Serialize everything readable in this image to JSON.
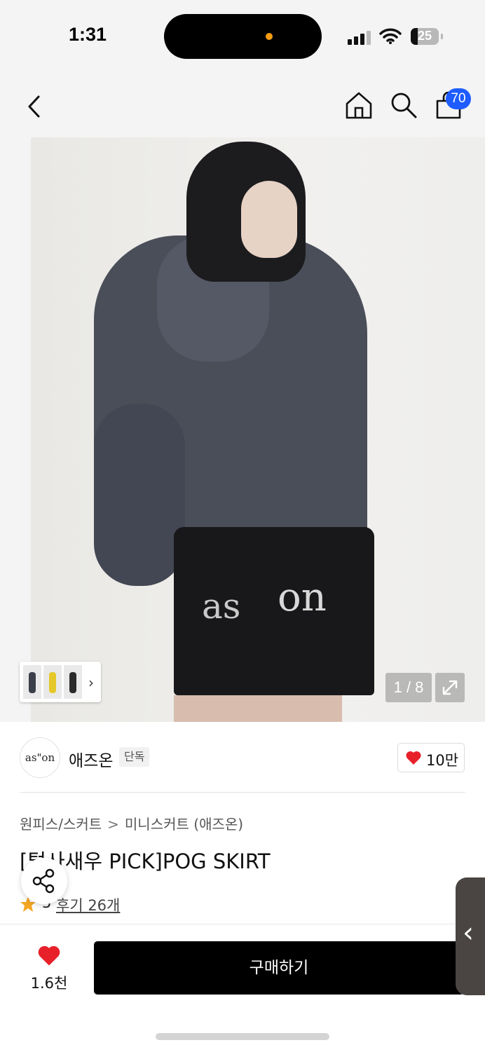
{
  "status_bar": {
    "time": "1:31",
    "battery": "25",
    "icons": [
      "signal-icon",
      "wifi-icon",
      "battery-icon"
    ]
  },
  "header": {
    "icons": [
      "back-icon",
      "home-icon",
      "search-icon",
      "shopping-bag-icon"
    ],
    "cart_count": "70"
  },
  "gallery": {
    "image_text_left": "as",
    "image_text_right": "on",
    "page_indicator": "1 / 8"
  },
  "brand": {
    "logo_text": "as\"on",
    "name": "애즈온",
    "tag": "단독",
    "likes": "10만"
  },
  "product": {
    "breadcrumb": [
      "원피스/스커트",
      "미니스커트 (애즈온)"
    ],
    "breadcrumb_separator": ">",
    "title": "[털사새우 PICK]POG SKIRT",
    "rating": "5",
    "reviews_label": "후기 26개"
  },
  "bottom_bar": {
    "wish_count": "1.6천",
    "buy_label": "구매하기"
  },
  "colors": {
    "accent_badge": "#1e5cff",
    "heart": "#e8202a",
    "star": "#f5a623",
    "buy_button": "#000000"
  }
}
